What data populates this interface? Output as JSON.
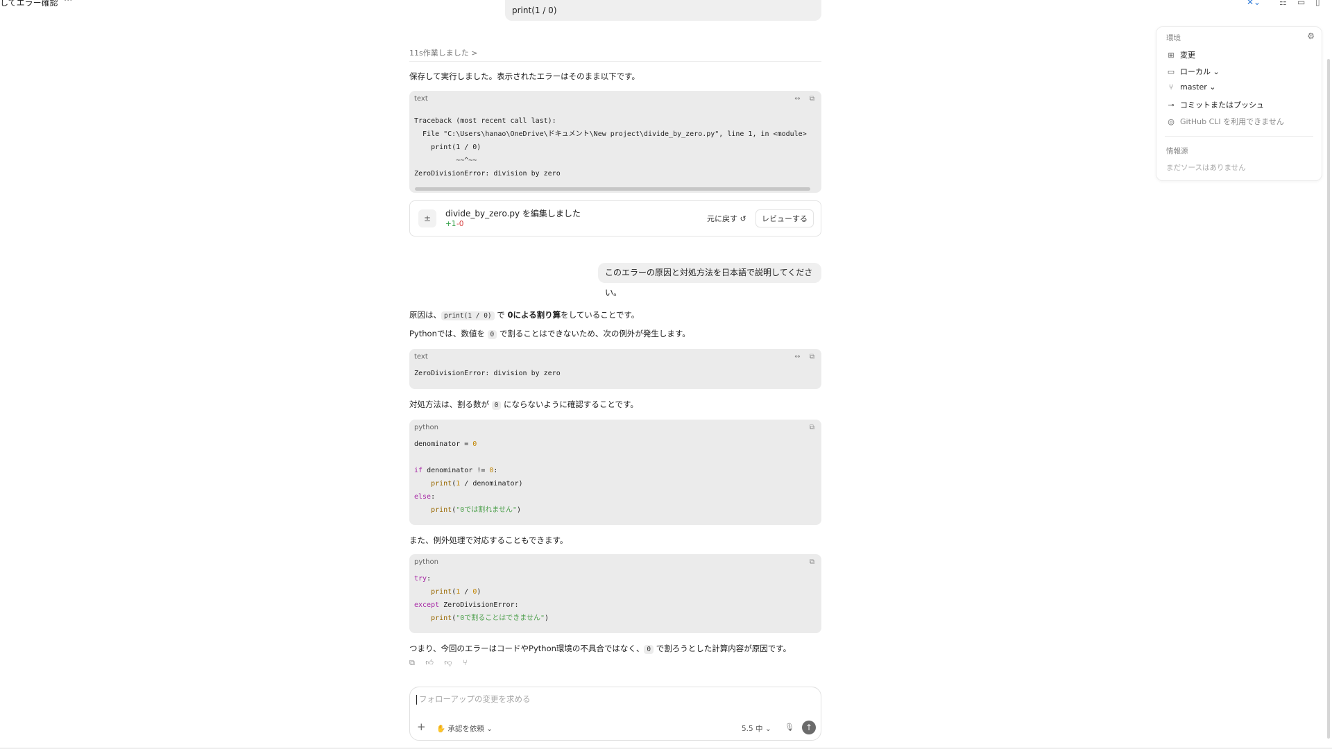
{
  "header": {
    "thread_title": "してエラー確認",
    "more_label": "···"
  },
  "chat": {
    "prev_user_message": "print(1 / 0)",
    "worked_label": "11s作業しました >",
    "assistant_intro": "保存して実行しました。表示されたエラーはそのまま以下です。",
    "traceback_block": {
      "lang": "text",
      "code": "Traceback (most recent call last):\n  File \"C:\\Users\\hanao\\OneDrive\\ドキュメント\\New project\\divide_by_zero.py\", line 1, in <module>\n    print(1 / 0)\n          ~~^~~\nZeroDivisionError: division by zero"
    },
    "edit_card": {
      "title": "divide_by_zero.py を編集しました",
      "added": "+1",
      "removed": "-0",
      "undo_label": "元に戻す ↺",
      "review_label": "レビューする"
    },
    "user_message": "このエラーの原因と対処方法を日本語で説明してください。",
    "answer": {
      "p1_prefix": "原因は、",
      "p1_code": "print(1 / 0)",
      "p1_mid": " で ",
      "p1_bold": "0による割り算",
      "p1_suffix": "をしていることです。",
      "p2_prefix": "Pythonでは、数値を ",
      "p2_code": "0",
      "p2_suffix": " で割ることはできないため、次の例外が発生します。",
      "error_block": {
        "lang": "text",
        "code": "ZeroDivisionError: division by zero"
      },
      "p3_prefix": "対処方法は、割る数が ",
      "p3_code": "0",
      "p3_suffix": " にならないように確認することです。",
      "code_block_1_lang": "python",
      "p4": "また、例外処理で対応することもできます。",
      "code_block_2_lang": "python",
      "p5_prefix": "つまり、今回のエラーはコードやPython環境の不具合ではなく、",
      "p5_code": "0",
      "p5_suffix": " で割ろうとした計算内容が原因です。"
    }
  },
  "composer": {
    "placeholder": "フォローアップの変更を求める",
    "approval_label": "承認を依頼",
    "model_label": "5.5 中"
  },
  "env_panel": {
    "title": "環境",
    "items": [
      {
        "label": "変更",
        "icon": "diff-icon"
      },
      {
        "label": "ローカル",
        "icon": "laptop-icon"
      },
      {
        "label": "master",
        "icon": "branch-icon"
      },
      {
        "label": "コミットまたはプッシュ",
        "icon": "commit-icon"
      },
      {
        "label": "GitHub CLI を利用できません",
        "icon": "github-icon"
      }
    ],
    "sources_title": "情報源",
    "sources_empty": "まだソースはありません"
  },
  "colors": {
    "keyword": "#a626a4",
    "number": "#c18401",
    "function": "#986801",
    "string": "#50a14f",
    "added": "#2f9e44",
    "removed": "#d63c3c"
  }
}
